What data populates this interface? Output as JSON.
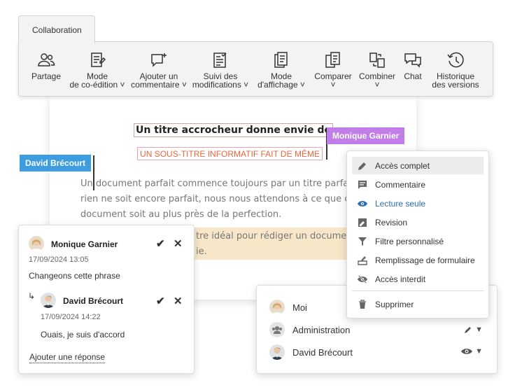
{
  "ribbon": {
    "tab_label": "Collaboration",
    "items": [
      {
        "label": "Partage",
        "icon": "share-users-icon"
      },
      {
        "label": "Mode\nde co-édition ˅",
        "icon": "coedit-mode-icon"
      },
      {
        "label": "Ajouter un\ncommentaire ˅",
        "icon": "add-comment-icon"
      },
      {
        "label": "Suivi des\nmodifications ˅",
        "icon": "track-changes-icon"
      },
      {
        "label": "Mode\nd'affichage ˅",
        "icon": "view-mode-icon"
      },
      {
        "label": "Comparer\n˅",
        "icon": "compare-icon"
      },
      {
        "label": "Combiner\n˅",
        "icon": "combine-icon"
      },
      {
        "label": "Chat",
        "icon": "chat-icon"
      },
      {
        "label": "Historique\ndes versions",
        "icon": "version-history-icon"
      }
    ]
  },
  "document": {
    "title": "Un titre accrocheur donne envie de lire",
    "subtitle": "UN SOUS-TITRE INFORMATIF FAIT DE MÊME",
    "body_line1": "Un document parfait commence toujours par un titre parfait. B",
    "body_line2": "rien ne soit encore parfait, nous nous attendons à ce que chaque",
    "body_line3": "document soit au plus près de la perfection.",
    "highlight_line1": "tre idéal pour rédiger un document",
    "highlight_line2": "ie."
  },
  "cursors": {
    "monique": {
      "name": "Monique Garnier",
      "color": "#c27ee8"
    },
    "david": {
      "name": "David Brécourt",
      "color": "#3e9ddf"
    }
  },
  "comment": {
    "author": "Monique Garnier",
    "date": "17/09/2024 13:05",
    "text": "Changeons cette phrase",
    "reply_author": "David Brécourt",
    "reply_date": "17/09/2024 14:22",
    "reply_text": "Ouais, je suis d'accord",
    "add_reply": "Ajouter une réponse"
  },
  "sharing": {
    "rows": [
      {
        "name": "Moi"
      },
      {
        "name": "Administration"
      },
      {
        "name": "David Brécourt"
      }
    ]
  },
  "access_menu": {
    "items": [
      {
        "label": "Accès complet",
        "icon": "pencil-icon"
      },
      {
        "label": "Commentaire",
        "icon": "comment-icon"
      },
      {
        "label": "Lecture seule",
        "icon": "eye-icon"
      },
      {
        "label": "Revision",
        "icon": "review-icon"
      },
      {
        "label": "Filtre personnalisé",
        "icon": "filter-icon"
      },
      {
        "label": "Remplissage de formulaire",
        "icon": "form-fill-icon"
      },
      {
        "label": "Accès interdit",
        "icon": "eye-slash-icon"
      },
      {
        "label": "Supprimer",
        "icon": "trash-icon"
      }
    ]
  },
  "colors": {
    "accent_blue": "#2a6fb5",
    "subtitle_orange": "#e8663d",
    "highlight": "#f7e7c8"
  }
}
